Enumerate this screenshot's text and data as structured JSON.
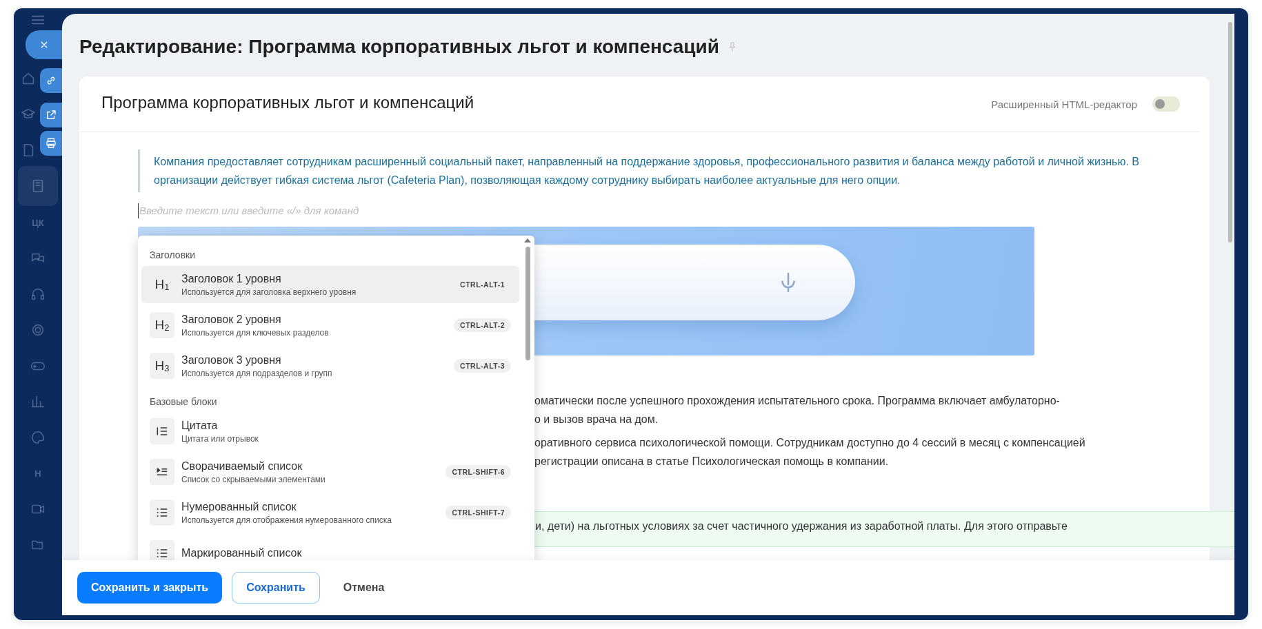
{
  "sidebar": {
    "items": [
      {
        "kind": "icon",
        "selected": false
      },
      {
        "kind": "icon",
        "selected": false
      },
      {
        "kind": "icon",
        "selected": false
      },
      {
        "kind": "icon",
        "selected": true
      },
      {
        "kind": "text",
        "label": "ЦК",
        "selected": false
      },
      {
        "kind": "icon",
        "selected": false
      },
      {
        "kind": "icon",
        "selected": false
      },
      {
        "kind": "icon",
        "selected": false
      },
      {
        "kind": "icon",
        "selected": false
      },
      {
        "kind": "icon",
        "selected": false
      },
      {
        "kind": "icon",
        "selected": false
      },
      {
        "kind": "text",
        "label": "Н",
        "selected": false
      },
      {
        "kind": "icon",
        "selected": false
      },
      {
        "kind": "icon",
        "selected": false
      }
    ]
  },
  "window": {
    "title": "Редактирование: Программа корпоративных льгот и компенсаций"
  },
  "card": {
    "title": "Программа корпоративных льгот и компенсаций",
    "toggle": {
      "label": "Расширенный HTML-редактор",
      "on": false
    },
    "quote": "Компания предоставляет сотрудникам расширенный социальный пакет, направленный на поддержание здоровья, профессионального развития и баланса между работой и личной жизнью. В организации действует гибкая система льгот (Cafeteria Plan), позволяющая каждому сотруднику выбирать наиболее актуальные для него опции.",
    "editor": {
      "placeholder": "Введите текст или введите «/» для команд"
    },
    "body_lines": [
      "оматически после успешного прохождения испытательного срока. Программа включает амбулаторно-",
      "о и вызов врача на дом.",
      "оративного сервиса психологической помощи. Сотрудникам доступно до 4 сессий в месяц с компенсацией",
      "регистрации описана в статье Психологическая помощь в компании."
    ],
    "callout": "и, дети) на льготных условиях за счет частичного удержания из заработной платы. Для этого отправьте"
  },
  "command_menu": {
    "sections": [
      {
        "title": "Заголовки",
        "items": [
          {
            "kind": "heading",
            "marker": "H$_{1}$",
            "title": "Заголовок 1 уровня",
            "description": "Используется для заголовка верхнего уровня",
            "shortcut": "CTRL-ALT-1",
            "selected": true
          },
          {
            "kind": "heading",
            "marker": "H$_{2}$",
            "title": "Заголовок 2 уровня",
            "description": "Используется для ключевых разделов",
            "shortcut": "CTRL-ALT-2",
            "selected": false
          },
          {
            "kind": "heading",
            "marker": "H$_{3}$",
            "title": "Заголовок 3 уровня",
            "description": "Используется для подразделов и групп",
            "shortcut": "CTRL-ALT-3",
            "selected": false
          }
        ]
      },
      {
        "title": "Базовые блоки",
        "items": [
          {
            "kind": "quote",
            "title": "Цитата",
            "description": "Цитата или отрывок",
            "selected": false
          },
          {
            "kind": "collapsible",
            "title": "Сворачиваемый список",
            "description": "Список со скрываемыми элементами",
            "shortcut": "CTRL-SHIFT-6",
            "selected": false
          },
          {
            "kind": "numbered",
            "title": "Нумерованный список",
            "description": "Используется для отображения нумерованного списка",
            "shortcut": "CTRL-SHIFT-7",
            "selected": false
          },
          {
            "kind": "bulleted",
            "title": "Маркированный список",
            "selected": false
          }
        ]
      }
    ]
  },
  "footer": {
    "buttons": [
      {
        "kind": "primary",
        "label": "Сохранить и закрыть"
      },
      {
        "kind": "secondary",
        "label": "Сохранить"
      },
      {
        "kind": "link",
        "label": "Отмена"
      }
    ]
  }
}
